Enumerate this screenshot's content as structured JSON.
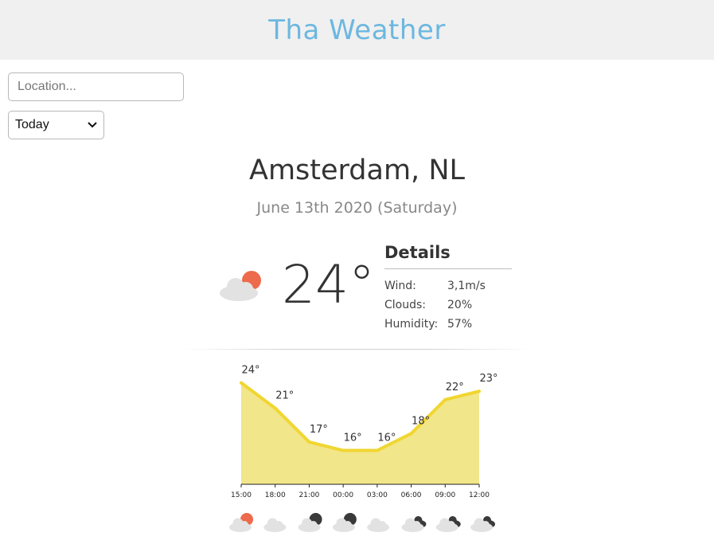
{
  "header": {
    "title": "Tha Weather"
  },
  "search": {
    "placeholder": "Location...",
    "value": ""
  },
  "period_select": {
    "selected": "Today"
  },
  "location": {
    "city": "Amsterdam, NL",
    "date": "June 13th 2020 (Saturday)"
  },
  "current": {
    "temperature": "24°",
    "icon": "partly-cloudy-day-icon",
    "details_title": "Details",
    "details": [
      {
        "label": "Wind:",
        "value": "3,1m/s"
      },
      {
        "label": "Clouds:",
        "value": "20%"
      },
      {
        "label": "Humidity:",
        "value": "57%"
      }
    ]
  },
  "colors": {
    "title": "#6cb7e0",
    "line": "#f0d630",
    "area": "#f2e68a",
    "sun": "#ee6a4c",
    "moon": "#3a3a3a",
    "cloud": "#e2e2e2"
  },
  "chart_data": {
    "type": "area",
    "categories": [
      "15:00",
      "18:00",
      "21:00",
      "00:00",
      "03:00",
      "06:00",
      "09:00",
      "12:00"
    ],
    "values": [
      24,
      21,
      17,
      16,
      16,
      18,
      22,
      23
    ],
    "value_labels": [
      "24°",
      "21°",
      "17°",
      "16°",
      "16°",
      "18°",
      "22°",
      "23°"
    ],
    "ylim": [
      12,
      25
    ],
    "grid": false
  },
  "forecast_icons": [
    "partly-cloudy-day-icon",
    "cloud-icon",
    "partly-cloudy-night-icon",
    "partly-cloudy-night-icon",
    "cloud-icon",
    "broken-clouds-icon",
    "broken-clouds-icon",
    "broken-clouds-icon"
  ]
}
